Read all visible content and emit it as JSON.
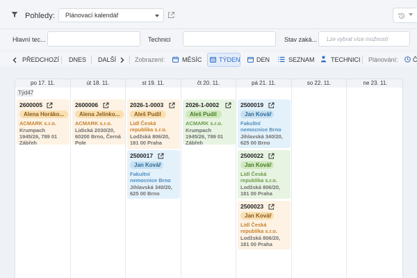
{
  "topbar": {
    "views_label": "Pohledy:",
    "views_value": "Plánovací kalendář"
  },
  "filters": {
    "technician_main_label": "Hlavní tec...",
    "technicians_label": "Technici",
    "order_state_label": "Stav zaká...",
    "order_state_placeholder": "Lze vybrat více možností"
  },
  "toolbar": {
    "prev": "PŘEDCHOZÍ",
    "today": "DNES",
    "next": "DALŠÍ",
    "display_label": "Zobrazení:",
    "month": "MĚSÍC",
    "week": "TÝDEN",
    "day": "DEN",
    "list": "SEZNAM",
    "technicians": "TECHNICI",
    "planning_label": "Plánování:",
    "planning_cut": "Č"
  },
  "calendar": {
    "week_label": "Týd47",
    "days": [
      "po 17. 11.",
      "út 18. 11.",
      "st 19. 11.",
      "čt 20. 11.",
      "pá 21. 11.",
      "so 22. 11.",
      "ne 23. 11."
    ],
    "events": {
      "mon": [
        {
          "id": "2600005",
          "tech": "Alena Horáko...",
          "company": "ACMARK s.r.o.",
          "address": "Krumpach 1945/26, 789 01 Zábřeh",
          "color": "orange"
        }
      ],
      "tue": [
        {
          "id": "2600006",
          "tech": "Alena Jelínko...",
          "company": "ACMARK s.r.o.",
          "address": "Lidická 2030/20, 60200 Brno, Černá Pole",
          "color": "orange"
        }
      ],
      "wed": [
        {
          "id": "2026-1-0003",
          "tech": "Aleš Pudil",
          "company": "Lidl Česká republika s.r.o.",
          "address": "Lodžská 806/20, 181 00 Praha",
          "color": "orange"
        },
        {
          "id": "2500017",
          "tech": "Jan Kovář",
          "company": "Fakultní nemocnice Brno",
          "address": "Jihlavská 340/20, 625 00 Brno",
          "color": "blue"
        }
      ],
      "thu": [
        {
          "id": "2026-1-0002",
          "tech": "Aleš Pudil",
          "company": "ACMARK s.r.o.",
          "address": "Krumpach 1945/26, 789 01 Zábřeh",
          "color": "green"
        }
      ],
      "fri": [
        {
          "id": "2500019",
          "tech": "Jan Kovář",
          "company": "Fakultní nemocnice Brno",
          "address": "Jihlavská 340/20, 625 00 Brno",
          "color": "blue"
        },
        {
          "id": "2500022",
          "tech": "Jan Kovář",
          "company": "Lidl Česká republika s.r.o.",
          "address": "Lodžská 806/20, 181 00 Praha",
          "color": "green"
        },
        {
          "id": "2500023",
          "tech": "Jan Kovář",
          "company": "Lidl Česká republika s.r.o.",
          "address": "Lodžská 806/20, 181 00 Praha",
          "color": "orange"
        }
      ]
    }
  },
  "colors": {
    "orange_bg": "#fdf2e3",
    "green_bg": "#e8f4e2",
    "blue_bg": "#e3f1fb",
    "accent": "#2f6bc4"
  }
}
